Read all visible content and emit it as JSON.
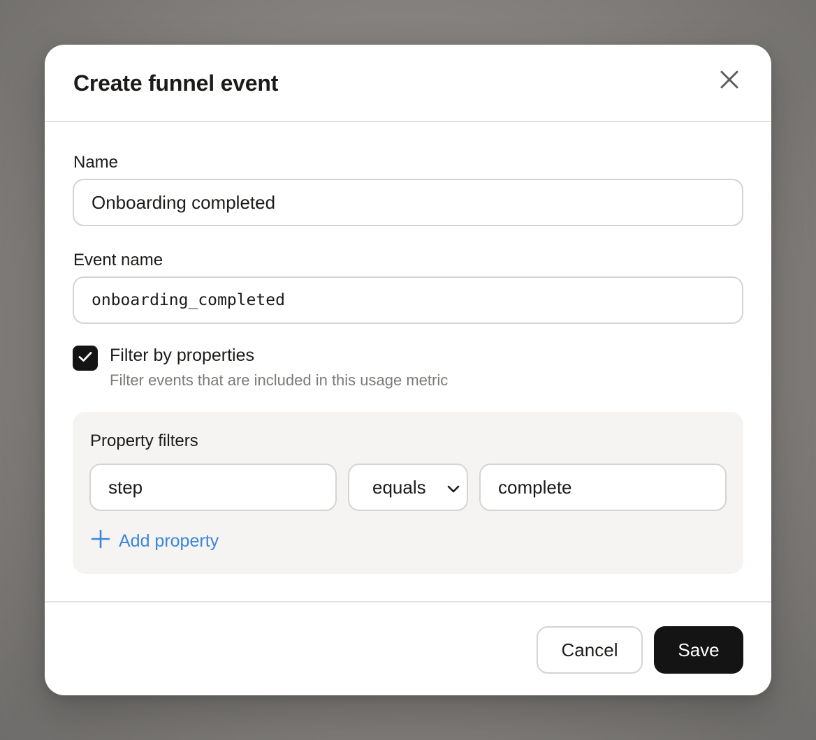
{
  "dialog": {
    "title": "Create funnel event",
    "close_icon": "close-icon"
  },
  "form": {
    "name": {
      "label": "Name",
      "value": "Onboarding completed"
    },
    "event_name": {
      "label": "Event name",
      "value": "onboarding_completed"
    },
    "filter_toggle": {
      "checked": true,
      "label": "Filter by properties",
      "description": "Filter events that are included in this usage metric"
    },
    "property_filters": {
      "title": "Property filters",
      "rows": [
        {
          "property": "step",
          "operator": "equals",
          "value": "complete"
        }
      ],
      "add_label": "Add property"
    }
  },
  "footer": {
    "cancel_label": "Cancel",
    "save_label": "Save"
  },
  "colors": {
    "primary_button": "#141414",
    "link": "#3a86db",
    "backdrop": "#84817e"
  }
}
